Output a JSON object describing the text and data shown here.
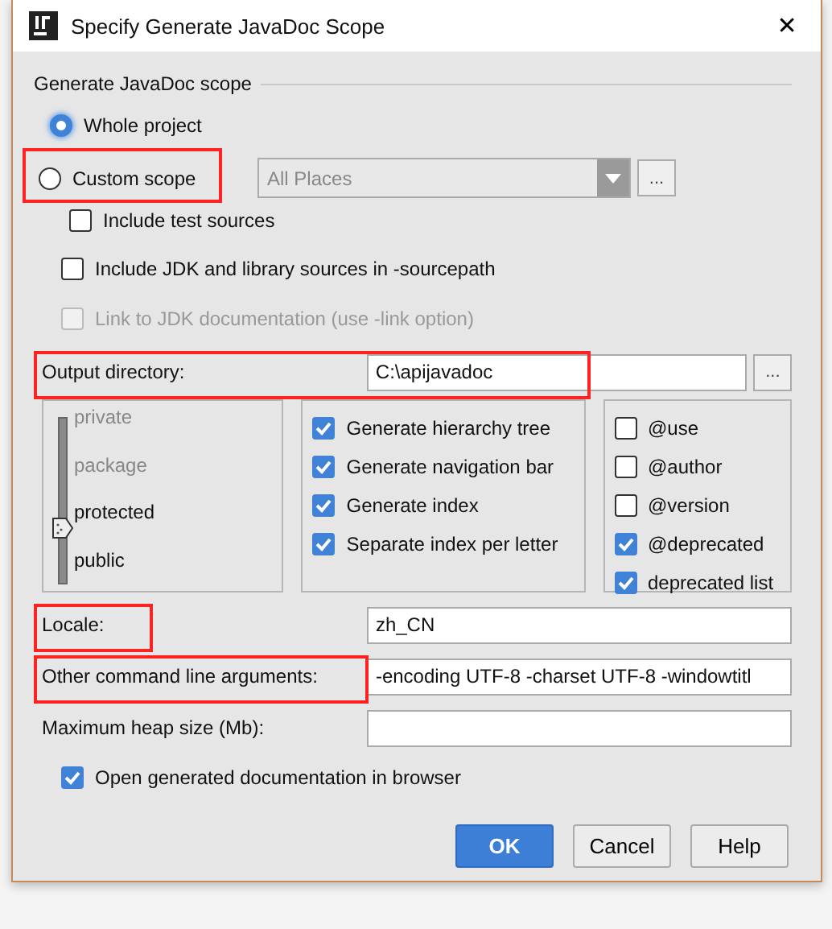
{
  "window": {
    "title": "Specify Generate JavaDoc Scope",
    "close": "✕"
  },
  "scope": {
    "heading": "Generate JavaDoc scope",
    "options": [
      {
        "label": "Whole project",
        "selected": true,
        "highlighted": false
      },
      {
        "label": "Custom scope",
        "selected": false,
        "highlighted": true
      }
    ],
    "scope_combo": {
      "value": "All Places",
      "disabled": true,
      "browse": "..."
    },
    "include_test": {
      "label": "Include test sources",
      "checked": false
    }
  },
  "include_jdk": {
    "label": "Include JDK and library sources in -sourcepath",
    "checked": false,
    "disabled": false
  },
  "link_jdk": {
    "label": "Link to JDK documentation (use -link option)",
    "checked": false,
    "disabled": true
  },
  "output_directory": {
    "label": "Output directory:",
    "value": "C:\\apijavadoc",
    "browse": "...",
    "highlighted": true
  },
  "access_levels": [
    {
      "label": "private",
      "selected": false
    },
    {
      "label": "package",
      "selected": false
    },
    {
      "label": "protected",
      "selected": true
    },
    {
      "label": "public",
      "selected": false
    }
  ],
  "generate_options": [
    {
      "label": "Generate hierarchy tree",
      "checked": true
    },
    {
      "label": "Generate navigation bar",
      "checked": true
    },
    {
      "label": "Generate index",
      "checked": true
    },
    {
      "label": "Separate index per letter",
      "checked": true
    }
  ],
  "tag_options": [
    {
      "label": "@use",
      "checked": false
    },
    {
      "label": "@author",
      "checked": false
    },
    {
      "label": "@version",
      "checked": false
    },
    {
      "label": "@deprecated",
      "checked": true
    },
    {
      "label": "deprecated list",
      "checked": true
    }
  ],
  "fields": [
    {
      "label": "Locale:",
      "value": "zh_CN",
      "highlighted": true
    },
    {
      "label": "Other command line arguments:",
      "value": "-encoding UTF-8 -charset UTF-8 -windowtitl",
      "highlighted": true
    },
    {
      "label": "Maximum heap size (Mb):",
      "highlighted": false
    }
  ],
  "open_browser": {
    "label": "Open generated documentation in browser",
    "checked": true
  },
  "buttons": [
    {
      "label": "OK",
      "default": true
    },
    {
      "label": "Cancel",
      "default": false
    },
    {
      "label": "Help",
      "default": false
    }
  ]
}
